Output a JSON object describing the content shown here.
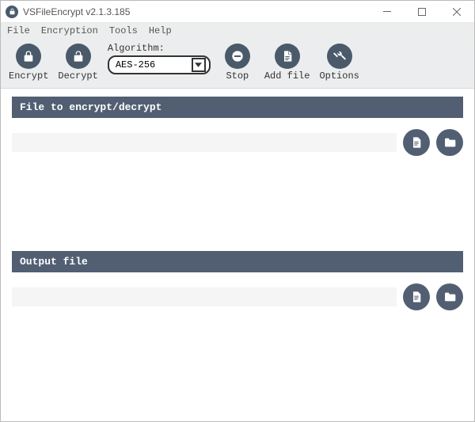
{
  "window": {
    "title": "VSFileEncrypt v2.1.3.185"
  },
  "menu": {
    "file": "File",
    "encryption": "Encryption",
    "tools": "Tools",
    "help": "Help"
  },
  "toolbar": {
    "encrypt": "Encrypt",
    "decrypt": "Decrypt",
    "algorithm_label": "Algorithm:",
    "algorithm_value": "AES-256",
    "stop": "Stop",
    "add_file": "Add file",
    "options": "Options"
  },
  "sections": {
    "input_header": "File to encrypt/decrypt",
    "input_value": "",
    "output_header": "Output file",
    "output_value": ""
  }
}
